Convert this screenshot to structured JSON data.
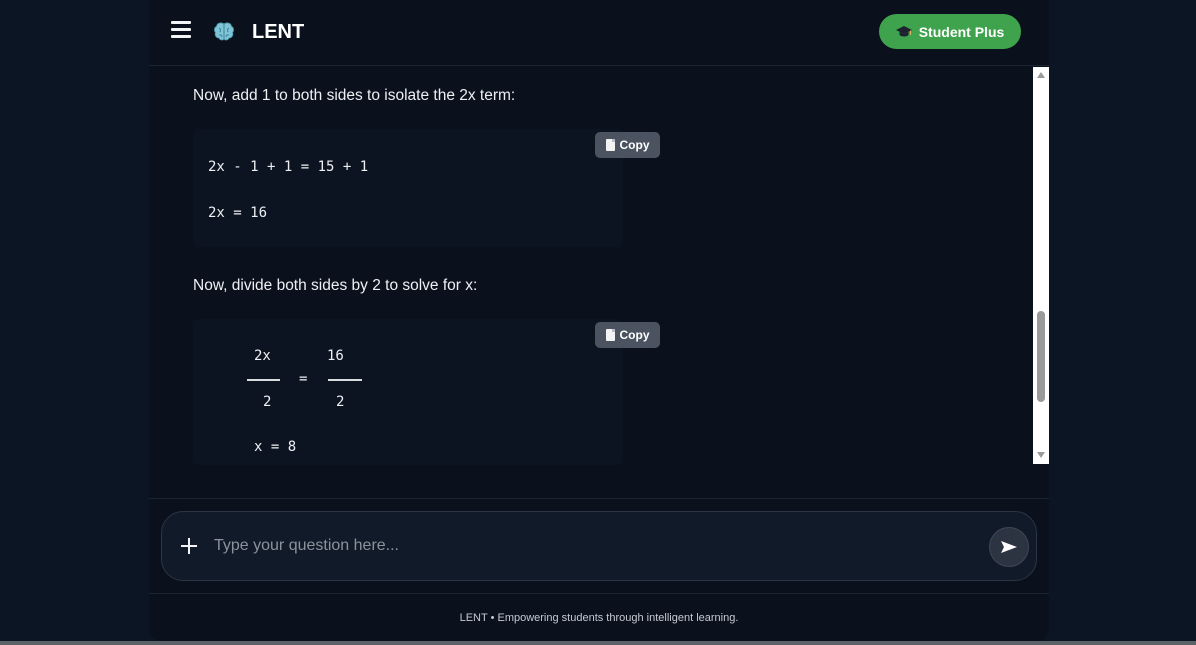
{
  "header": {
    "title": "LENT",
    "plan_button_label": "Student Plus",
    "accent_color": "#3fa34d"
  },
  "chat": {
    "step1_text": "Now, add 1 to both sides to isolate the 2x term:",
    "code1": {
      "copy_label": "Copy",
      "line1": "2x - 1 + 1 = 15 + 1",
      "line2": "2x = 16"
    },
    "step2_text": "Now, divide both sides by 2 to solve for x:",
    "code2": {
      "copy_label": "Copy",
      "left_numerator": "2x",
      "left_denominator": "2",
      "equals": "=",
      "right_numerator": "16",
      "right_denominator": "2",
      "result": "x = 8"
    }
  },
  "composer": {
    "placeholder": "Type your question here..."
  },
  "footer": {
    "text": "LENT • Empowering students through intelligent learning."
  },
  "icons": {
    "menu": "hamburger-icon",
    "logo": "brain-icon",
    "plan": "graduation-cap-icon",
    "copy": "document-icon",
    "attach": "plus-icon",
    "send": "send-arrow-icon"
  }
}
